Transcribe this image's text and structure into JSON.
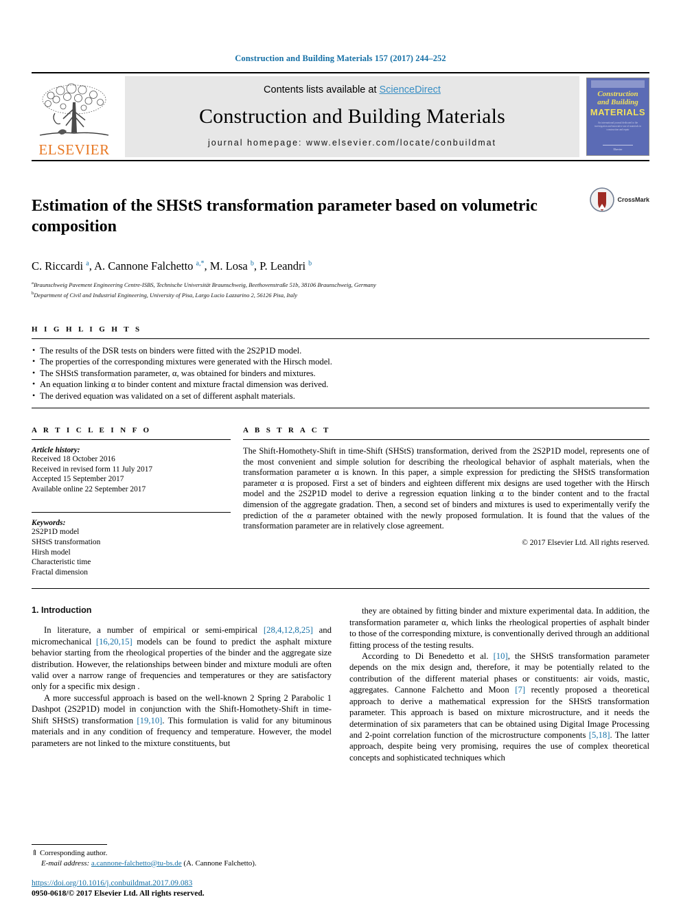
{
  "running_head": "Construction and Building Materials 157 (2017) 244–252",
  "masthead": {
    "publisher_name": "ELSEVIER",
    "contents_prefix": "Contents lists available at ",
    "contents_link": "ScienceDirect",
    "journal_title": "Construction and Building Materials",
    "homepage": "journal homepage: www.elsevier.com/locate/conbuildmat",
    "cover": {
      "line1": "Construction",
      "line2": "and Building",
      "line3": "MATERIALS",
      "blurb": "An international journal dedicated to the investigation and innovative use of materials in construction and repair",
      "footer": "Elsevier"
    }
  },
  "article": {
    "title": "Estimation of the SHStS transformation parameter based on volumetric composition",
    "crossmark_label": "CrossMark",
    "authors_html": "C. Riccardi <sup>a</sup>, A. Cannone Falchetto <sup>a,*</sup>, M. Losa <sup>b</sup>, P. Leandri <sup>b</sup>",
    "affiliations": [
      "a Braunschweig Pavement Engineering Centre-ISBS, Technische Universität Braunschweig, Beethovenstraße 51b, 38106 Braunschweig, Germany",
      "b Department of Civil and Industrial Engineering, University of Pisa, Largo Lucio Lazzarino 2, 56126 Pisa, Italy"
    ]
  },
  "highlights": {
    "heading": "H I G H L I G H T S",
    "items": [
      "The results of the DSR tests on binders were fitted with the 2S2P1D model.",
      "The properties of the corresponding mixtures were generated with the Hirsch model.",
      "The SHStS transformation parameter, α, was obtained for binders and mixtures.",
      "An equation linking α to binder content and mixture fractal dimension was derived.",
      "The derived equation was validated on a set of different asphalt materials."
    ]
  },
  "article_info": {
    "heading": "A R T I C L E    I N F O",
    "history_title": "Article history:",
    "history": [
      "Received 18 October 2016",
      "Received in revised form 11 July 2017",
      "Accepted 15 September 2017",
      "Available online 22 September 2017"
    ],
    "keywords_title": "Keywords:",
    "keywords": [
      "2S2P1D model",
      "SHStS transformation",
      "Hirsh model",
      "Characteristic time",
      "Fractal dimension"
    ]
  },
  "abstract": {
    "heading": "A B S T R A C T",
    "text": "The Shift-Homothety-Shift in time-Shift (SHStS) transformation, derived from the 2S2P1D model, represents one of the most convenient and simple solution for describing the rheological behavior of asphalt materials, when the transformation parameter α is known. In this paper, a simple expression for predicting the SHStS transformation parameter α is proposed. First a set of binders and eighteen different mix designs are used together with the Hirsch model and the 2S2P1D model to derive a regression equation linking α to the binder content and to the fractal dimension of the aggregate gradation. Then, a second set of binders and mixtures is used to experimentally verify the prediction of the α parameter obtained with the newly proposed formulation. It is found that the values of the transformation parameter are in relatively close agreement.",
    "copyright": "© 2017 Elsevier Ltd. All rights reserved."
  },
  "body": {
    "section_heading": "1. Introduction",
    "left_paragraphs": [
      {
        "parts": [
          {
            "t": "In literature, a number of empirical or semi-empirical "
          },
          {
            "t": "[28,4,12,8,25]",
            "link": true
          },
          {
            "t": " and micromechanical "
          },
          {
            "t": "[16,20,15]",
            "link": true
          },
          {
            "t": " models can be found to predict the asphalt mixture behavior starting from the rheological properties of the binder and the aggregate size distribution. However, the relationships between binder and mixture moduli are often valid over a narrow range of frequencies and temperatures or they are satisfactory only for a specific mix design ."
          }
        ]
      },
      {
        "parts": [
          {
            "t": "A more successful approach is based on the well-known 2 Spring 2 Parabolic 1 Dashpot (2S2P1D) model in conjunction with the Shift-Homothety-Shift in time-Shift SHStS) transformation "
          },
          {
            "t": "[19,10]",
            "link": true
          },
          {
            "t": ". This formulation is valid for any bituminous materials and in any condition of frequency and temperature. However, the model parameters are not linked to the mixture constituents, but"
          }
        ]
      }
    ],
    "right_paragraphs": [
      {
        "parts": [
          {
            "t": "they are obtained by fitting binder and mixture experimental data. In addition, the transformation parameter α, which links the rheological properties of asphalt binder to those of the corresponding mixture, is conventionally derived through an additional fitting process of the testing results."
          }
        ],
        "noindent": false
      },
      {
        "parts": [
          {
            "t": "According to Di Benedetto et al. "
          },
          {
            "t": "[10]",
            "link": true
          },
          {
            "t": ", the SHStS transformation parameter depends on the mix design and, therefore, it may be potentially related to the contribution of the different material phases or constituents: air voids, mastic, aggregates. Cannone Falchetto and Moon "
          },
          {
            "t": "[7]",
            "link": true
          },
          {
            "t": " recently proposed a theoretical approach to derive a mathematical expression for the SHStS transformation parameter. This approach is based on mixture microstructure, and it needs the determination of six parameters that can be obtained using Digital Image Processing and 2-point correlation function of the microstructure components "
          },
          {
            "t": "[5,18]",
            "link": true
          },
          {
            "t": ". The latter approach, despite being very promising, requires the use of complex theoretical concepts and sophisticated techniques which"
          }
        ]
      }
    ]
  },
  "footer": {
    "corresponding_marker": "⇑",
    "corresponding_text": "Corresponding author.",
    "email_label": "E-mail address:",
    "email": "a.cannone-falchetto@tu-bs.de",
    "email_owner": "(A. Cannone Falchetto).",
    "doi": "https://doi.org/10.1016/j.conbuildmat.2017.09.083",
    "issn": "0950-0618/© 2017 Elsevier Ltd. All rights reserved."
  },
  "colors": {
    "link": "#1570a6",
    "elsevier_orange": "#e87722",
    "cover_blue": "#5b6bb5",
    "cover_yellow": "#f2e15c"
  }
}
